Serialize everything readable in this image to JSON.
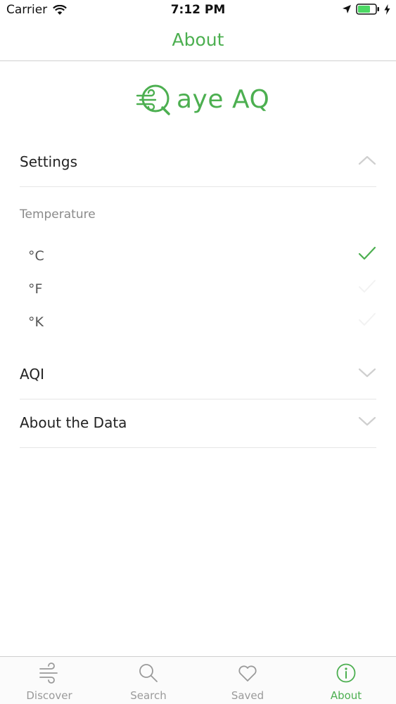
{
  "status_bar": {
    "carrier": "Carrier",
    "time": "7:12 PM"
  },
  "nav": {
    "title": "About"
  },
  "logo": {
    "text": "aye AQ"
  },
  "settings": {
    "label": "Settings",
    "expanded": true,
    "temperature": {
      "heading": "Temperature",
      "units": [
        {
          "label": "°C",
          "selected": true
        },
        {
          "label": "°F",
          "selected": false
        },
        {
          "label": "°K",
          "selected": false
        }
      ]
    }
  },
  "aqi": {
    "label": "AQI",
    "expanded": false
  },
  "about_data": {
    "label": "About the Data",
    "expanded": false
  },
  "tabs": [
    {
      "label": "Discover",
      "icon": "wind-icon",
      "active": false
    },
    {
      "label": "Search",
      "icon": "search-icon",
      "active": false
    },
    {
      "label": "Saved",
      "icon": "heart-icon",
      "active": false
    },
    {
      "label": "About",
      "icon": "info-icon",
      "active": true
    }
  ],
  "colors": {
    "accent": "#4caf50",
    "inactive": "#9a9a9a"
  }
}
